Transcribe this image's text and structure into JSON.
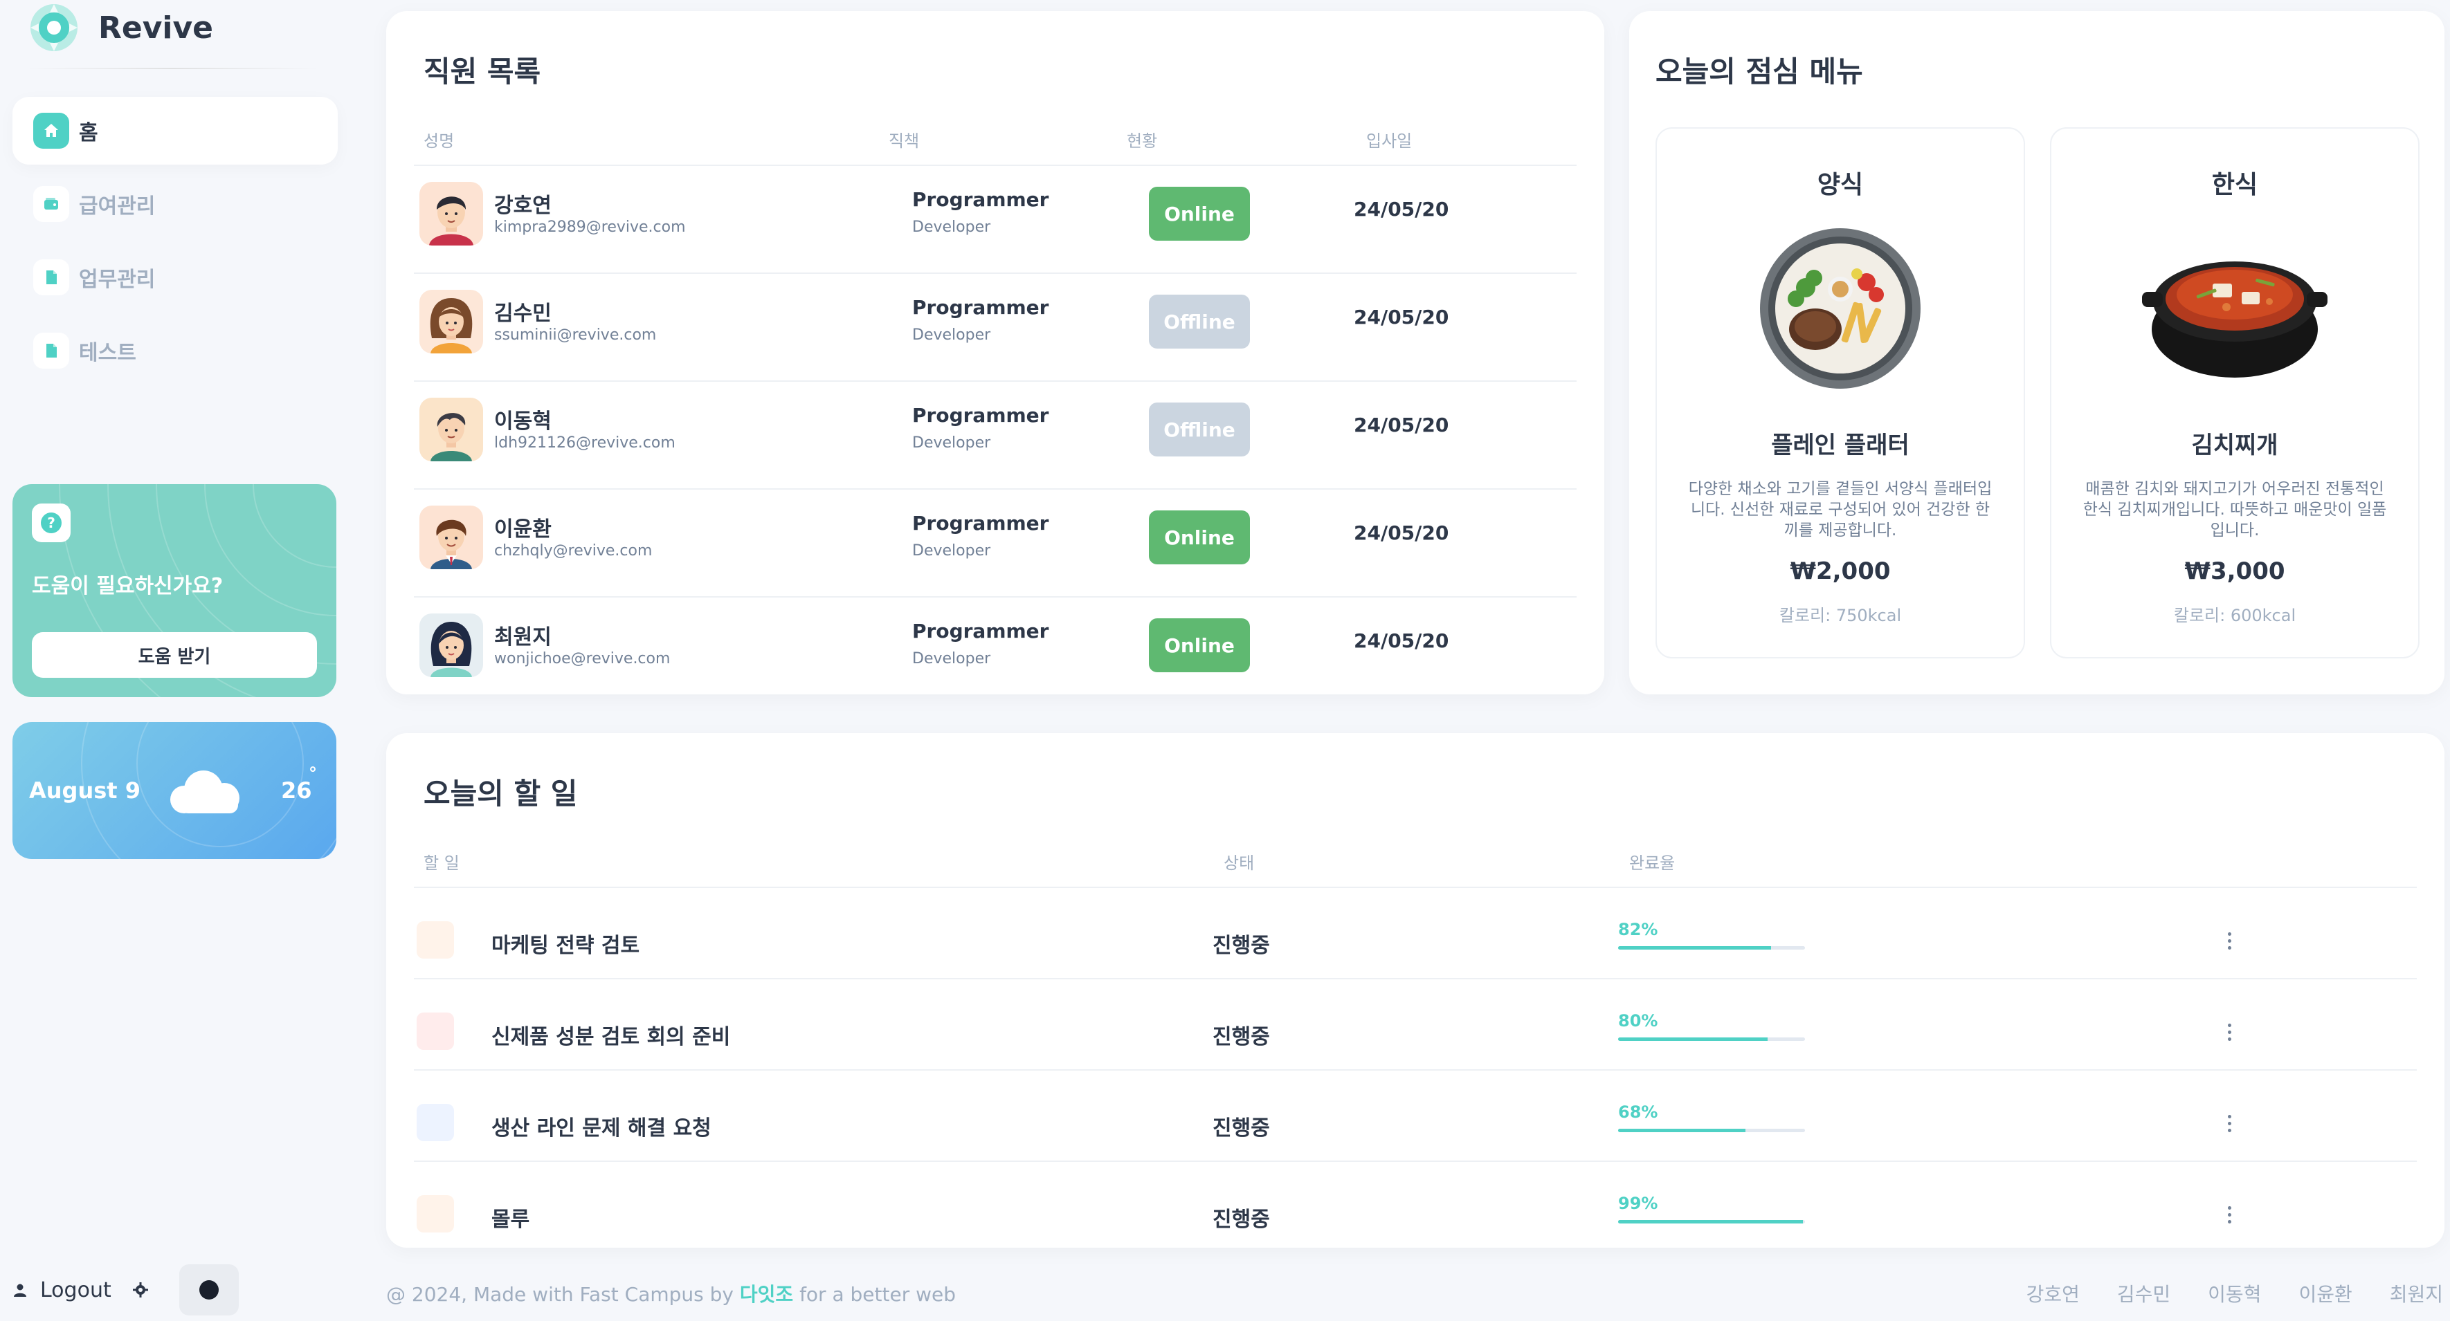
{
  "brand": {
    "name": "Revive",
    "logo_icon": "revive-logo-icon",
    "accent": "#4fd1c5"
  },
  "sidebar": {
    "items": [
      {
        "label": "홈",
        "icon": "home-icon",
        "active": true
      },
      {
        "label": "급여관리",
        "icon": "wallet-icon",
        "active": false
      },
      {
        "label": "업무관리",
        "icon": "document-icon",
        "active": false
      },
      {
        "label": "테스트",
        "icon": "document-icon",
        "active": false
      }
    ],
    "help": {
      "title": "도움이 필요하신가요?",
      "button": "도움 받기",
      "icon": "question-icon"
    },
    "weather": {
      "date": "August 9",
      "temp": "26",
      "degree": "°",
      "icon": "cloud-icon"
    },
    "logout": "Logout"
  },
  "employees": {
    "title": "직원 목록",
    "headers": {
      "name": "성명",
      "role": "직책",
      "status": "현황",
      "joined": "입사일"
    },
    "rows": [
      {
        "name": "강호연",
        "email": "kimpra2989@revive.com",
        "role": "Programmer",
        "dept": "Developer",
        "status": "Online",
        "date": "24/05/20"
      },
      {
        "name": "김수민",
        "email": "ssuminii@revive.com",
        "role": "Programmer",
        "dept": "Developer",
        "status": "Offline",
        "date": "24/05/20"
      },
      {
        "name": "이동혁",
        "email": "ldh921126@revive.com",
        "role": "Programmer",
        "dept": "Developer",
        "status": "Offline",
        "date": "24/05/20"
      },
      {
        "name": "이윤환",
        "email": "chzhqly@revive.com",
        "role": "Programmer",
        "dept": "Developer",
        "status": "Online",
        "date": "24/05/20"
      },
      {
        "name": "최원지",
        "email": "wonjichoe@revive.com",
        "role": "Programmer",
        "dept": "Developer",
        "status": "Online",
        "date": "24/05/20"
      }
    ],
    "status_colors": {
      "Online": "#5fb971",
      "Offline": "#cbd5e0"
    }
  },
  "lunch": {
    "title": "오늘의 점심 메뉴",
    "menus": [
      {
        "category": "양식",
        "name": "플레인 플래터",
        "desc": "다양한 채소와 고기를 곁들인 서양식 플래터입니다. 신선한 재료로 구성되어 있어 건강한 한 끼를 제공합니다.",
        "price": "₩2,000",
        "calories": "칼로리: 750kcal",
        "image": "platter-plate-image"
      },
      {
        "category": "한식",
        "name": "김치찌개",
        "desc": "매콤한 김치와 돼지고기가 어우러진 전통적인 한식 김치찌개입니다. 따뜻하고 매운맛이 일품입니다.",
        "price": "₩3,000",
        "calories": "칼로리: 600kcal",
        "image": "kimchi-stew-pot-image"
      }
    ]
  },
  "todos": {
    "title": "오늘의 할 일",
    "headers": {
      "task": "할 일",
      "state": "상태",
      "progress": "완료율"
    },
    "rows": [
      {
        "task": "마케팅 전략 검토",
        "state": "진행중",
        "progress": 82,
        "progress_label": "82%",
        "color": "#fff3ea"
      },
      {
        "task": "신제품 성분 검토 회의 준비",
        "state": "진행중",
        "progress": 80,
        "progress_label": "80%",
        "color": "#ffecec"
      },
      {
        "task": "생산 라인 문제 해결 요청",
        "state": "진행중",
        "progress": 68,
        "progress_label": "68%",
        "color": "#edf3ff"
      },
      {
        "task": "몰루",
        "state": "진행중",
        "progress": 99,
        "progress_label": "99%",
        "color": "#fff3ea"
      }
    ]
  },
  "footer": {
    "prefix": "@ 2024, Made with Fast Campus by ",
    "author": "다잇조",
    "suffix": " for a better web",
    "links": [
      "강호연",
      "김수민",
      "이동혁",
      "이윤환",
      "최원지"
    ]
  }
}
